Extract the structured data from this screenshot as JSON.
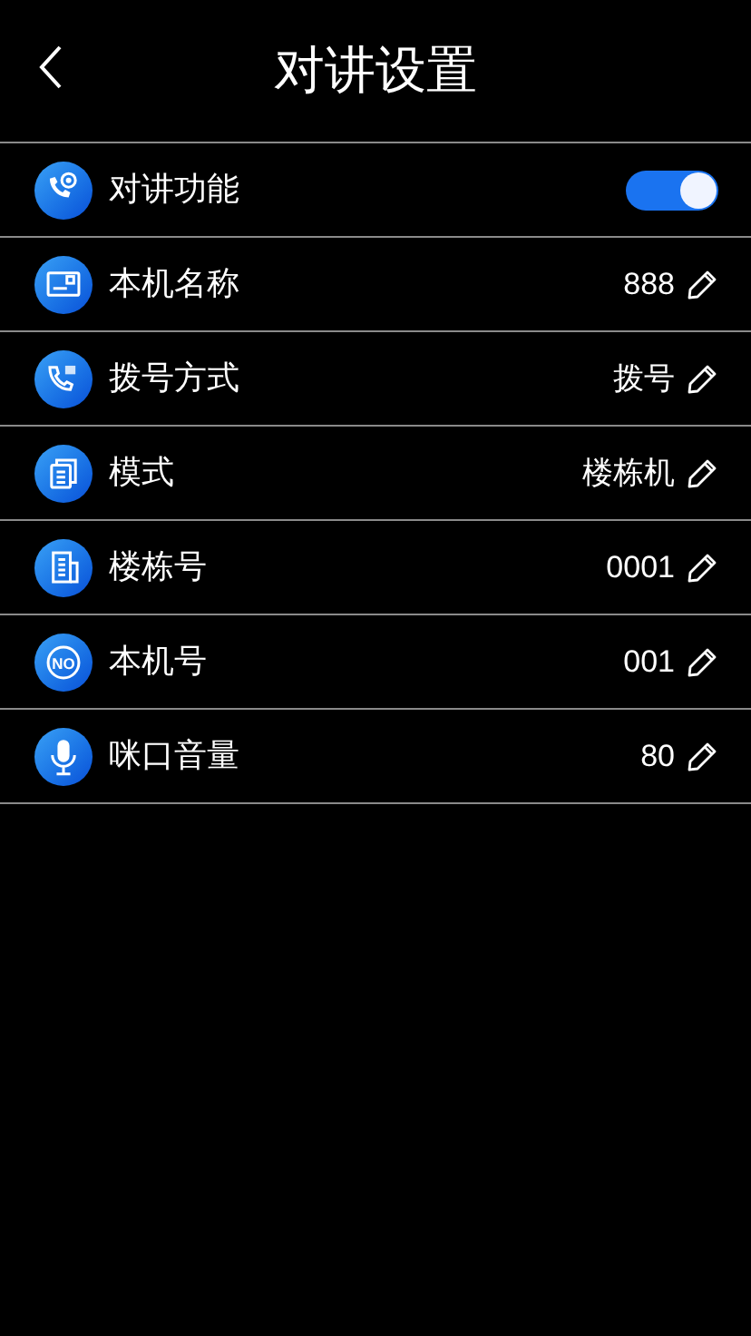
{
  "header": {
    "title": "对讲设置"
  },
  "rows": [
    {
      "kind": "toggle",
      "label": "对讲功能",
      "on": true
    },
    {
      "kind": "value",
      "label": "本机名称",
      "value": "888"
    },
    {
      "kind": "value",
      "label": "拨号方式",
      "value": "拨号"
    },
    {
      "kind": "value",
      "label": "模式",
      "value": "楼栋机"
    },
    {
      "kind": "value",
      "label": "楼栋号",
      "value": "0001"
    },
    {
      "kind": "value",
      "icon_text": "NO",
      "label": "本机号",
      "value": "001"
    },
    {
      "kind": "value",
      "label": "咪口音量",
      "value": "80"
    }
  ]
}
